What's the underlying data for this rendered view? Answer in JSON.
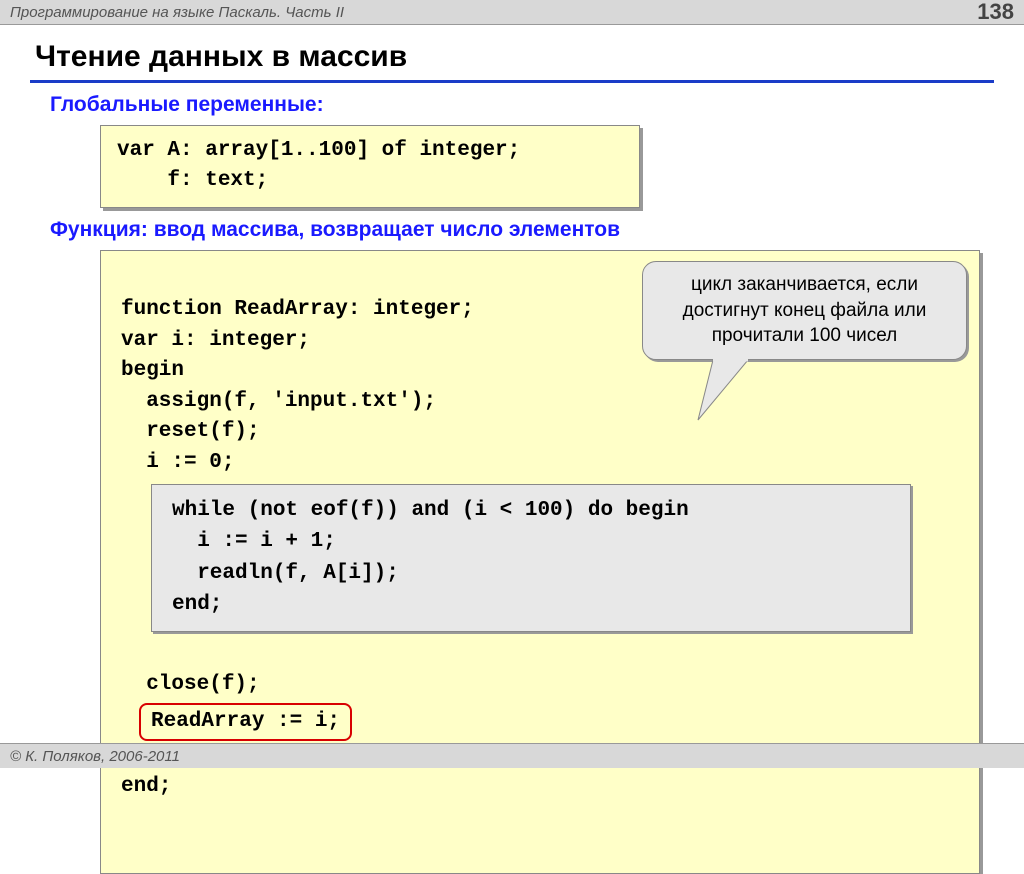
{
  "header": {
    "breadcrumb": "Программирование на языке Паскаль. Часть II",
    "pagenum": "138"
  },
  "title": "Чтение данных в массив",
  "section1": "Глобальные переменные:",
  "code1": "var A: array[1..100] of integer;\n    f: text;",
  "section2": "Функция: ввод массива, возвращает число элементов",
  "code2_top": "function ReadArray: integer;\nvar i: integer;\nbegin\n  assign(f, 'input.txt');\n  reset(f);\n  i := 0;",
  "code2_inner": "while (not eof(f)) and (i < 100) do begin\n  i := i + 1;\n  readln(f, A[i]);\nend;",
  "code2_after": "  close(f);",
  "code2_red": "ReadArray := i;",
  "code2_end": "end;",
  "callout": "цикл заканчивается, если достигнут конец файла или прочитали 100 чисел",
  "footer": "© К. Поляков, 2006-2011"
}
